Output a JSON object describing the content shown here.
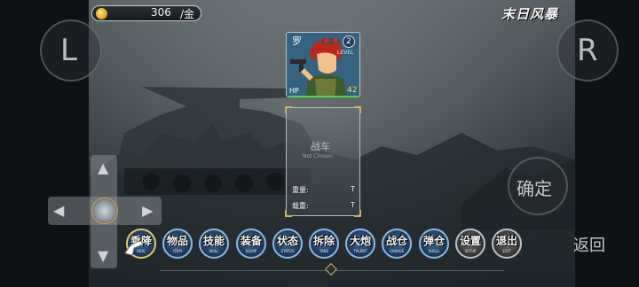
{
  "hud": {
    "coins": "306",
    "coin_unit": "/金",
    "logo": "末日风暴"
  },
  "shoulder": {
    "left": "L",
    "right": "R"
  },
  "character": {
    "name": "罗",
    "level": "2",
    "level_label": "LEVEL",
    "hp_label": "HP",
    "hp_value": "42",
    "hp_fill_fraction": 1.0
  },
  "vehicle": {
    "title": "战车",
    "subtitle": "Not Chosen",
    "weight_label": "重量:",
    "weight_unit": "T",
    "load_label": "载重:",
    "load_unit": "T"
  },
  "buttons": {
    "confirm": "确定",
    "back": "返回"
  },
  "menu": [
    {
      "label": "乘降",
      "sub": "RIDE"
    },
    {
      "label": "物品",
      "sub": "ITEM"
    },
    {
      "label": "技能",
      "sub": "SKILL"
    },
    {
      "label": "装备",
      "sub": "EQUIP"
    },
    {
      "label": "状态",
      "sub": "STATUS"
    },
    {
      "label": "拆除",
      "sub": "TAKE"
    },
    {
      "label": "大炮",
      "sub": "TALENT"
    },
    {
      "label": "战仓",
      "sub": "GARAGE"
    },
    {
      "label": "弹仓",
      "sub": "SHELL"
    },
    {
      "label": "设置",
      "sub": "SETUP"
    },
    {
      "label": "退出",
      "sub": "EXIT"
    }
  ],
  "colors": {
    "accent_gold": "#e6c86a",
    "menu_blue": "#2f5a86",
    "hp_green": "#4cd44c"
  }
}
